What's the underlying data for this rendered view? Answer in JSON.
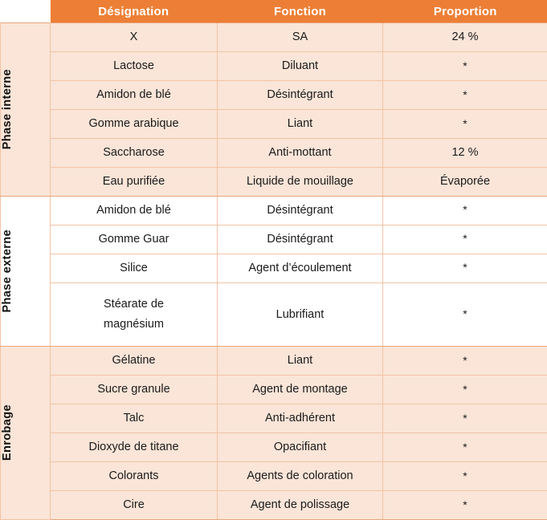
{
  "table": {
    "corner_label": "",
    "columns": [
      "Désignation",
      "Fonction",
      "Proportion"
    ],
    "sections": [
      {
        "label": "Phase interne",
        "shading": "tint",
        "rows": [
          {
            "designation": "X",
            "fonction": "SA",
            "proportion": "24 %"
          },
          {
            "designation": "Lactose",
            "fonction": "Diluant",
            "proportion": "*"
          },
          {
            "designation": "Amidon de blé",
            "fonction": "Désintégrant",
            "proportion": "*"
          },
          {
            "designation": "Gomme arabique",
            "fonction": "Liant",
            "proportion": "*"
          },
          {
            "designation": "Saccharose",
            "fonction": "Anti-mottant",
            "proportion": "12 %"
          },
          {
            "designation": "Eau purifiée",
            "fonction": "Liquide de mouillage",
            "proportion": "Évaporée"
          }
        ]
      },
      {
        "label": "Phase externe",
        "shading": "plain",
        "rows": [
          {
            "designation": "Amidon de blé",
            "fonction": "Désintégrant",
            "proportion": "*"
          },
          {
            "designation": "Gomme Guar",
            "fonction": "Désintégrant",
            "proportion": "*"
          },
          {
            "designation": "Silice",
            "fonction": "Agent d’écoulement",
            "proportion": "*"
          },
          {
            "designation": "Stéarate de\nmagnésium",
            "fonction": "Lubrifiant",
            "proportion": "*"
          }
        ]
      },
      {
        "label": "Enrobage",
        "shading": "tint",
        "rows": [
          {
            "designation": "Gélatine",
            "fonction": "Liant",
            "proportion": "*"
          },
          {
            "designation": "Sucre granule",
            "fonction": "Agent de montage",
            "proportion": "*"
          },
          {
            "designation": "Talc",
            "fonction": "Anti-adhérent",
            "proportion": "*"
          },
          {
            "designation": "Dioxyde de titane",
            "fonction": "Opacifiant",
            "proportion": "*"
          },
          {
            "designation": "Colorants",
            "fonction": "Agents de coloration",
            "proportion": "*"
          },
          {
            "designation": "Cire",
            "fonction": "Agent de polissage",
            "proportion": "*"
          }
        ]
      }
    ]
  },
  "colors": {
    "header_background": "#EC7F35",
    "header_text": "#FFFFFF",
    "row_tint": "#FAE5D8",
    "row_plain": "#FFFFFF",
    "grid_line": "#F3C3A4",
    "band_line": "#E8A679",
    "body_text": "#1A1A1A"
  }
}
